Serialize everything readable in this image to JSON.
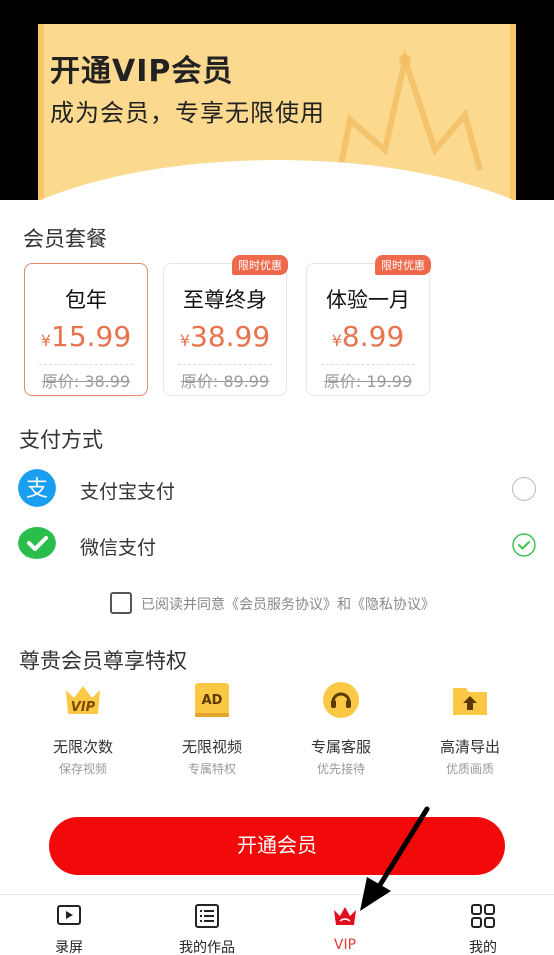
{
  "header": {
    "title": "开通VIP会员",
    "subtitle": "成为会员，专享无限使用"
  },
  "plans_section": {
    "title": "会员套餐",
    "plans": [
      {
        "name": "包年",
        "currency": "¥",
        "price": "15.99",
        "original": "原价: 38.99",
        "badge": "",
        "selected": true
      },
      {
        "name": "至尊终身",
        "currency": "¥",
        "price": "38.99",
        "original": "原价: 89.99",
        "badge": "限时优惠",
        "selected": false
      },
      {
        "name": "体验一月",
        "currency": "¥",
        "price": "8.99",
        "original": "原价: 19.99",
        "badge": "限时优惠",
        "selected": false
      }
    ]
  },
  "payment": {
    "title": "支付方式",
    "methods": [
      {
        "label": "支付宝支付",
        "icon": "alipay-icon",
        "checked": false
      },
      {
        "label": "微信支付",
        "icon": "wechat-pay-icon",
        "checked": true
      }
    ]
  },
  "agreement": {
    "text": "已阅读并同意《会员服务协议》和《隐私协议》"
  },
  "privileges": {
    "title": "尊贵会员尊享特权",
    "items": [
      {
        "title": "无限次数",
        "sub": "保存视频",
        "icon": "vip-crown-icon"
      },
      {
        "title": "无限视频",
        "sub": "专属特权",
        "icon": "ad-free-icon"
      },
      {
        "title": "专属客服",
        "sub": "优先接待",
        "icon": "headset-icon"
      },
      {
        "title": "高清导出",
        "sub": "优质画质",
        "icon": "export-folder-icon"
      }
    ]
  },
  "cta": {
    "label": "开通会员"
  },
  "bottom_nav": {
    "items": [
      {
        "label": "录屏",
        "icon": "record-icon"
      },
      {
        "label": "我的作品",
        "icon": "list-icon"
      },
      {
        "label": "VIP",
        "icon": "crown-icon",
        "active": true
      },
      {
        "label": "我的",
        "icon": "grid-icon"
      }
    ]
  },
  "colors": {
    "accent_red": "#f2090a",
    "price_orange": "#e8734d",
    "header_gold": "#fbd98f",
    "check_green": "#3fc24f"
  }
}
